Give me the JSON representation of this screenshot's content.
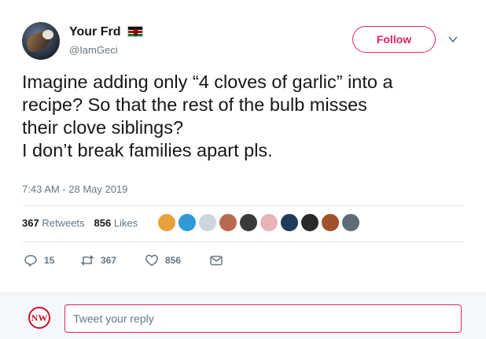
{
  "user": {
    "display_name": "Your Frd",
    "handle": "@IamGeci",
    "flag_icon": "kenya-flag-icon"
  },
  "follow_button": {
    "label": "Follow",
    "color": "#e0245e"
  },
  "tweet": {
    "lines": [
      "Imagine adding only “4 cloves of garlic” into a",
      "recipe? So that the rest of the bulb misses",
      "their clove siblings?",
      "I don’t break families apart pls."
    ],
    "timestamp": "7:43 AM - 28 May 2019"
  },
  "stats": {
    "retweets_count": "367",
    "retweets_label": "Retweets",
    "likes_count": "856",
    "likes_label": "Likes"
  },
  "liker_colors": [
    "#e8a23c",
    "#2e9bd6",
    "#ccd6dd",
    "#b86a4e",
    "#3a3a3a",
    "#e8b4b8",
    "#1f3a5c",
    "#2a2a2a",
    "#a0522d",
    "#5f6b78"
  ],
  "actions": {
    "reply_count": "15",
    "retweet_count": "367",
    "like_count": "856"
  },
  "reply": {
    "placeholder": "Tweet your reply",
    "avatar_text": "NW"
  }
}
